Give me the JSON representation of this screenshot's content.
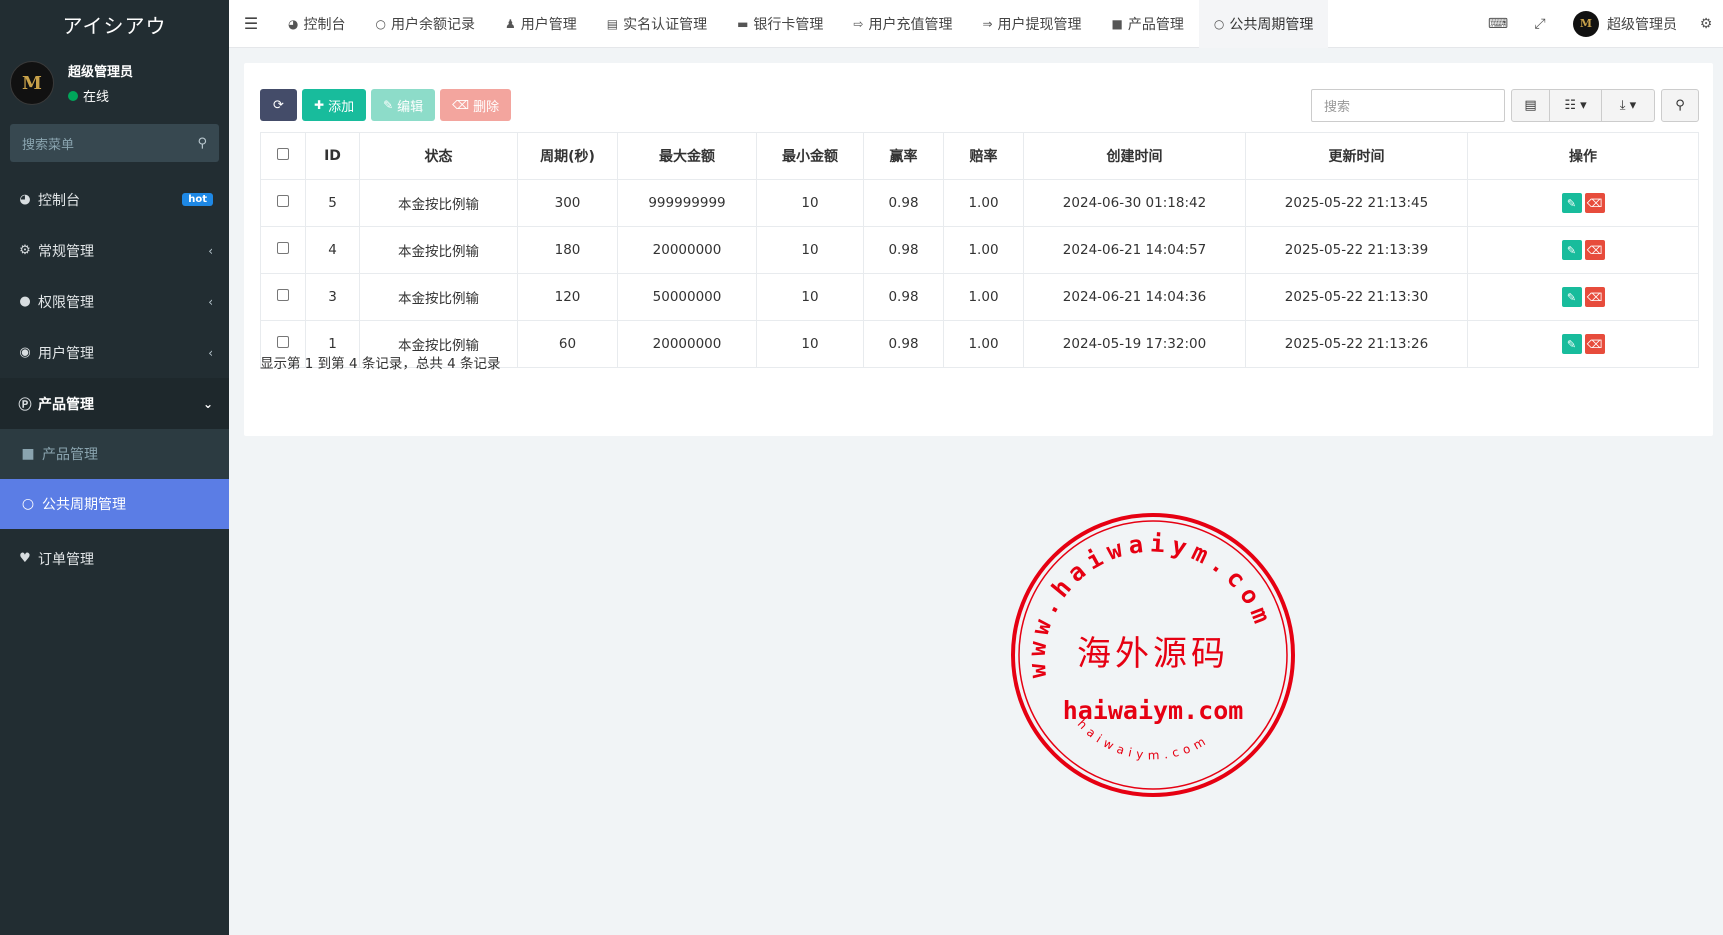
{
  "brand": "アイシアウ",
  "user": {
    "name": "超级管理员",
    "status": "在线",
    "avatar_letter": "M"
  },
  "sidebar": {
    "search_placeholder": "搜索菜单",
    "items": [
      {
        "label": "控制台",
        "icon": "dashboard-icon",
        "badge": "hot"
      },
      {
        "label": "常规管理",
        "icon": "cogs-icon"
      },
      {
        "label": "权限管理",
        "icon": "group-icon"
      },
      {
        "label": "用户管理",
        "icon": "user-circle-icon"
      },
      {
        "label": "产品管理",
        "icon": "product-icon",
        "open": true,
        "children": [
          {
            "label": "产品管理",
            "icon": "shopping-bag-icon"
          },
          {
            "label": "公共周期管理",
            "icon": "circle-icon",
            "active": true
          }
        ]
      },
      {
        "label": "订单管理",
        "icon": "heartbeat-icon"
      }
    ]
  },
  "header": {
    "tabs": [
      {
        "label": "控制台",
        "icon": "dashboard-icon"
      },
      {
        "label": "用户余额记录",
        "icon": "circle-icon"
      },
      {
        "label": "用户管理",
        "icon": "user-icon"
      },
      {
        "label": "实名认证管理",
        "icon": "id-card-icon"
      },
      {
        "label": "银行卡管理",
        "icon": "credit-card-icon"
      },
      {
        "label": "用户充值管理",
        "icon": "sign-in-icon"
      },
      {
        "label": "用户提现管理",
        "icon": "sign-out-icon"
      },
      {
        "label": "产品管理",
        "icon": "shopping-bag-icon"
      },
      {
        "label": "公共周期管理",
        "icon": "circle-icon",
        "active": true
      }
    ],
    "user_name": "超级管理员"
  },
  "toolbar": {
    "add_label": "添加",
    "edit_label": "编辑",
    "delete_label": "删除",
    "search_placeholder": "搜索"
  },
  "table": {
    "columns": [
      "ID",
      "状态",
      "周期(秒)",
      "最大金额",
      "最小金额",
      "赢率",
      "赔率",
      "创建时间",
      "更新时间",
      "操作"
    ],
    "rows": [
      {
        "id": "5",
        "status": "本金按比例输",
        "period": "300",
        "max": "999999999",
        "min": "10",
        "win": "0.98",
        "odds": "1.00",
        "created": "2024-06-30 01:18:42",
        "updated": "2025-05-22 21:13:45"
      },
      {
        "id": "4",
        "status": "本金按比例输",
        "period": "180",
        "max": "20000000",
        "min": "10",
        "win": "0.98",
        "odds": "1.00",
        "created": "2024-06-21 14:04:57",
        "updated": "2025-05-22 21:13:39"
      },
      {
        "id": "3",
        "status": "本金按比例输",
        "period": "120",
        "max": "50000000",
        "min": "10",
        "win": "0.98",
        "odds": "1.00",
        "created": "2024-06-21 14:04:36",
        "updated": "2025-05-22 21:13:30"
      },
      {
        "id": "1",
        "status": "本金按比例输",
        "period": "60",
        "max": "20000000",
        "min": "10",
        "win": "0.98",
        "odds": "1.00",
        "created": "2024-05-19 17:32:00",
        "updated": "2025-05-22 21:13:26"
      }
    ]
  },
  "pager_info": "显示第 1 到第 4 条记录，总共 4 条记录",
  "stamp": {
    "arc_text": "www.haiwaiym.com",
    "center_text": "海外源码",
    "domain_text": "haiwaiym.com",
    "bottom_arc_text": "haiwaiym.com",
    "color": "#e60012"
  }
}
